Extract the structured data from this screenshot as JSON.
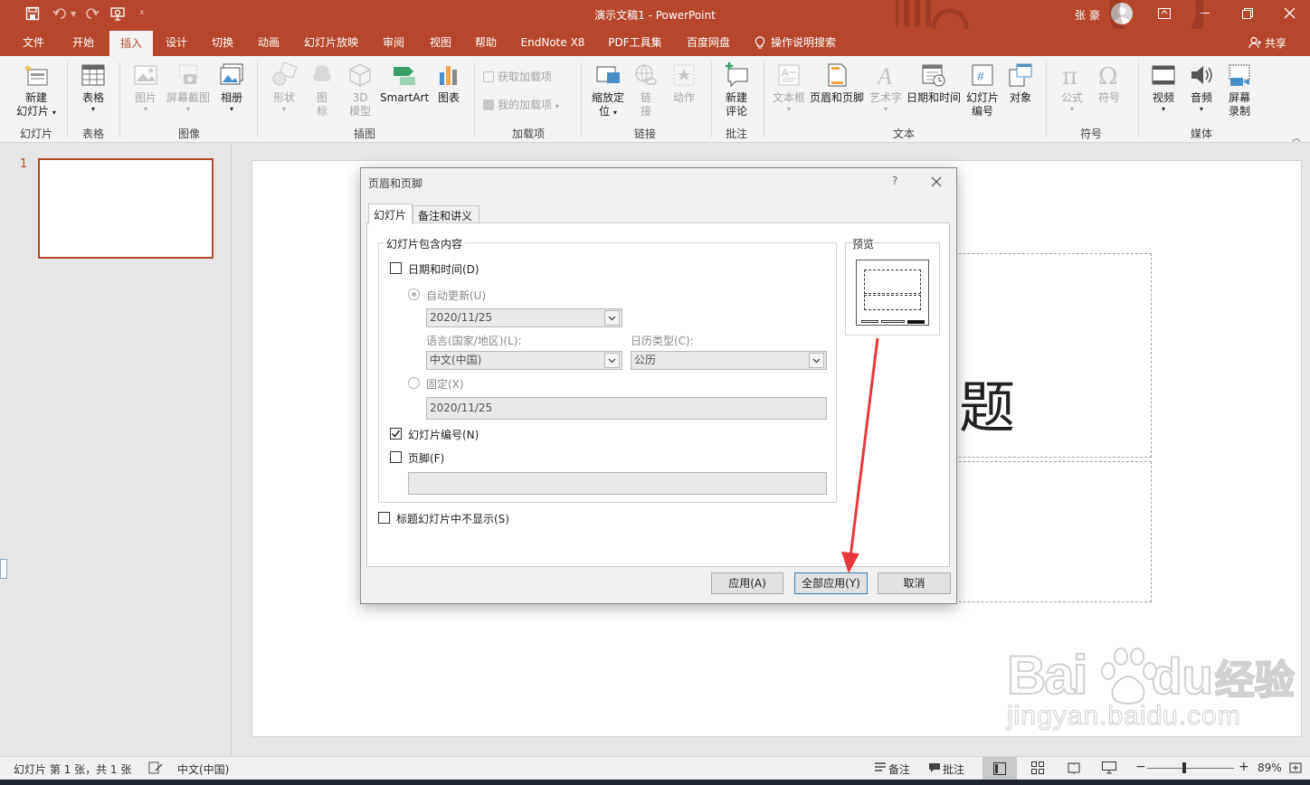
{
  "window": {
    "title": "演示文稿1  -  PowerPoint",
    "user_name": "张 豪",
    "share_label": "共享"
  },
  "tabs": [
    "文件",
    "开始",
    "插入",
    "设计",
    "切换",
    "动画",
    "幻灯片放映",
    "审阅",
    "视图",
    "帮助",
    "EndNote X8",
    "PDF工具集",
    "百度网盘",
    "操作说明搜索"
  ],
  "active_tab": "插入",
  "ribbon": {
    "groups": {
      "slides": "幻灯片",
      "tables": "表格",
      "images": "图像",
      "illustrations": "插图",
      "addins": "加载项",
      "links": "链接",
      "comments": "批注",
      "text": "文本",
      "symbols": "符号",
      "media": "媒体"
    },
    "buttons": {
      "new_slide_1": "新建",
      "new_slide_2": "幻灯片",
      "table": "表格",
      "picture": "图片",
      "screenshot": "屏幕截图",
      "album": "相册",
      "shapes": "形状",
      "icons_1": "图",
      "icons_2": "标",
      "model3d_1": "3D",
      "model3d_2": "模型",
      "smartart": "SmartArt",
      "chart": "图表",
      "get_addins": "获取加载项",
      "my_addins": "我的加载项",
      "zoom_1": "缩放定",
      "zoom_2": "位",
      "link_1": "链",
      "link_2": "接",
      "action": "动作",
      "new_comment_1": "新建",
      "new_comment_2": "评论",
      "textbox": "文本框",
      "header_footer": "页眉和页脚",
      "wordart": "艺术字",
      "datetime": "日期和时间",
      "slide_number_1": "幻灯片",
      "slide_number_2": "编号",
      "object": "对象",
      "equation": "公式",
      "symbol": "符号",
      "video": "视频",
      "audio": "音频",
      "screen_rec_1": "屏幕",
      "screen_rec_2": "录制"
    }
  },
  "thumbnail_number": "1",
  "slide_title_fragment": "题",
  "dialog": {
    "title": "页眉和页脚",
    "help": "?",
    "tab_slide": "幻灯片",
    "tab_notes": "备注和讲义",
    "group_label": "幻灯片包含内容",
    "datetime_label": "日期和时间(D)",
    "datetime_checked": false,
    "auto_update_label": "自动更新(U)",
    "auto_update_value": "2020/11/25",
    "language_label": "语言(国家/地区)(L):",
    "language_value": "中文(中国)",
    "calendar_label": "日历类型(C):",
    "calendar_value": "公历",
    "fixed_label": "固定(X)",
    "fixed_value": "2020/11/25",
    "slide_number_label": "幻灯片编号(N)",
    "slide_number_checked": true,
    "footer_label": "页脚(F)",
    "footer_checked": false,
    "footer_value": "",
    "title_slide_label": "标题幻灯片中不显示(S)",
    "title_slide_checked": false,
    "preview_label": "预览",
    "apply_label": "应用(A)",
    "apply_all_label": "全部应用(Y)",
    "cancel_label": "取消"
  },
  "status": {
    "slide_info": "幻灯片 第 1 张，共 1 张",
    "language": "中文(中国)",
    "notes": "备注",
    "comments": "批注",
    "zoom": "89%"
  },
  "watermark": {
    "brand": "Bai",
    "brand_suffix": "du",
    "brand_cn": "经验",
    "url": "jingyan.baidu.com"
  },
  "colors": {
    "accent": "#b7472a",
    "arrow": "#e8383d"
  }
}
